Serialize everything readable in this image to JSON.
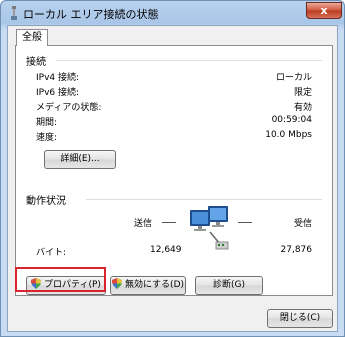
{
  "window": {
    "title": "ローカル エリア接続の状態",
    "close_glyph": "x",
    "icon": "network-connection-icon"
  },
  "tabs": [
    {
      "label": "全般"
    }
  ],
  "connection": {
    "heading": "接続",
    "rows": [
      {
        "label": "IPv4 接続:",
        "value": "ローカル"
      },
      {
        "label": "IPv6 接続:",
        "value": "限定"
      },
      {
        "label": "メディアの状態:",
        "value": "有効"
      },
      {
        "label": "期間:",
        "value": "00:59:04"
      },
      {
        "label": "速度:",
        "value": "10.0 Mbps"
      }
    ],
    "details_button": "詳細(E)..."
  },
  "activity": {
    "heading": "動作状況",
    "sent_label": "送信",
    "received_label": "受信",
    "bytes_label": "バイト:",
    "bytes_sent": "12,649",
    "bytes_received": "27,876",
    "icon": "network-activity-icon"
  },
  "actions": {
    "properties": "プロパティ(P)",
    "disable": "無効にする(D)",
    "diagnose": "診断(G)",
    "close": "閉じる(C)"
  },
  "colors": {
    "highlight": "#d9232e",
    "title_bar": "#b8d2ee"
  }
}
